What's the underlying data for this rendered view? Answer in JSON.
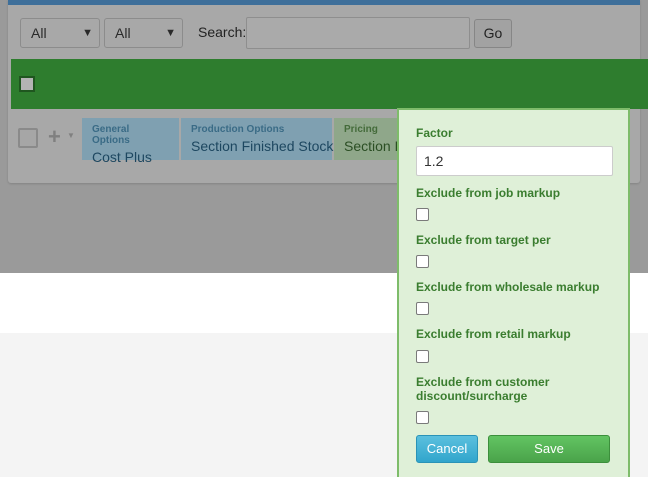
{
  "filters": {
    "select1": "All",
    "select2": "All",
    "search_label": "Search:",
    "search_value": "",
    "go_label": "Go"
  },
  "row": {
    "tags": [
      {
        "category": "General Options",
        "value": "Cost Plus"
      },
      {
        "category": "Production Options",
        "value": "Section Finished Stock"
      },
      {
        "category": "Pricing",
        "value": "Section F"
      }
    ]
  },
  "popover": {
    "factor_label": "Factor",
    "factor_value": "1.2",
    "options": [
      {
        "label": "Exclude from job markup",
        "checked": false
      },
      {
        "label": "Exclude from target per",
        "checked": false
      },
      {
        "label": "Exclude from wholesale markup",
        "checked": false
      },
      {
        "label": "Exclude from retail markup",
        "checked": false
      },
      {
        "label": "Exclude from customer discount/surcharge",
        "checked": false
      }
    ],
    "cancel_label": "Cancel",
    "save_label": "Save"
  },
  "colors": {
    "header_green": "#2e7d2e",
    "popover_bg": "#dff0d8",
    "label_green": "#3a7d2f",
    "cancel_blue": "#5bc0de",
    "save_green": "#5cb85c"
  }
}
